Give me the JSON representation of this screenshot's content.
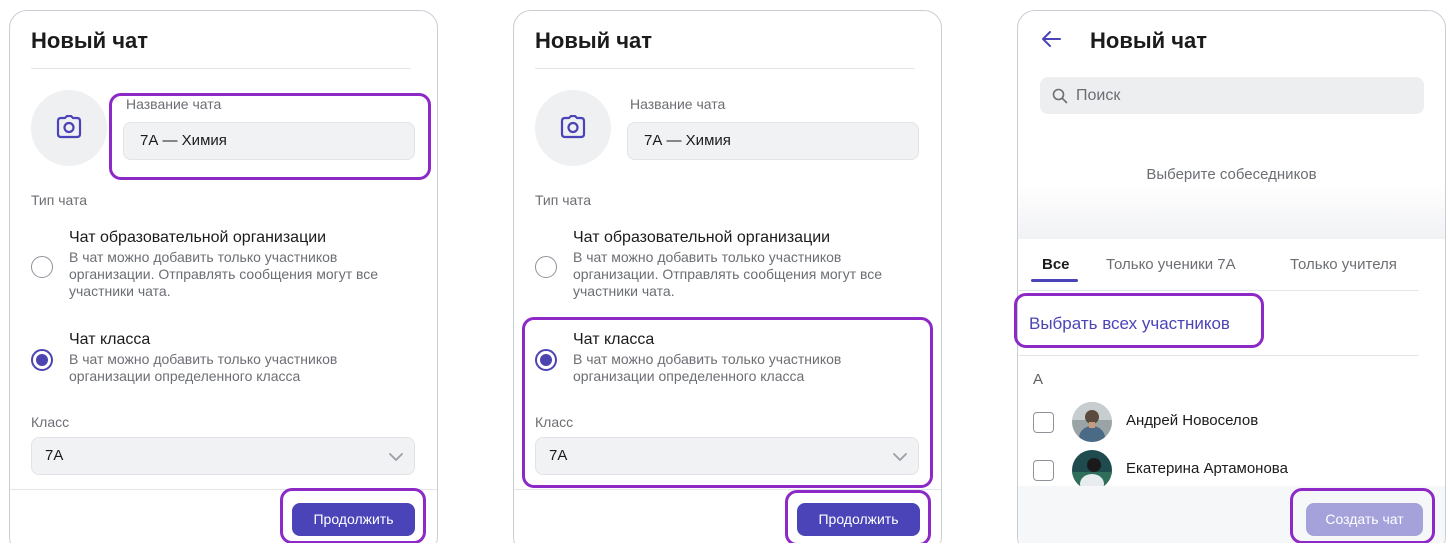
{
  "panel1": {
    "title": "Новый чат",
    "name_label": "Название чата",
    "name_value": "7А — Химия",
    "chat_type_label": "Тип чата",
    "option_org": {
      "title": "Чат образовательной организации",
      "desc": "В чат можно добавить только участников организации. Отправлять сообщения могут все участники чата."
    },
    "option_class": {
      "title": "Чат класса",
      "desc": "В чат можно добавить только участников организации определенного класса"
    },
    "class_label": "Класс",
    "class_value": "7А",
    "continue_button": "Продолжить"
  },
  "panel2": {
    "title": "Новый чат",
    "name_label": "Название чата",
    "name_value": "7А — Химия",
    "chat_type_label": "Тип чата",
    "option_org": {
      "title": "Чат образовательной организации",
      "desc": "В чат можно добавить только участников организации. Отправлять сообщения могут все участники чата."
    },
    "option_class": {
      "title": "Чат класса",
      "desc": "В чат можно добавить только участников организации определенного класса"
    },
    "class_label": "Класс",
    "class_value": "7А",
    "continue_button": "Продолжить"
  },
  "panel3": {
    "title": "Новый чат",
    "search_placeholder": "Поиск",
    "empty_hint": "Выберите собеседников",
    "tabs": [
      "Все",
      "Только ученики 7А",
      "Только учителя"
    ],
    "select_all": "Выбрать всех участников",
    "letter_header": "А",
    "participants": [
      {
        "name": "Андрей Новоселов"
      },
      {
        "name": "Екатерина Артамонова"
      }
    ],
    "create_button": "Создать чат"
  },
  "colors": {
    "accent": "#4b44b8",
    "highlight": "#8c29c7",
    "button_disabled": "#a5a1db"
  },
  "icons": [
    "camera-icon",
    "chevron-down-icon",
    "back-arrow-icon",
    "search-icon"
  ]
}
